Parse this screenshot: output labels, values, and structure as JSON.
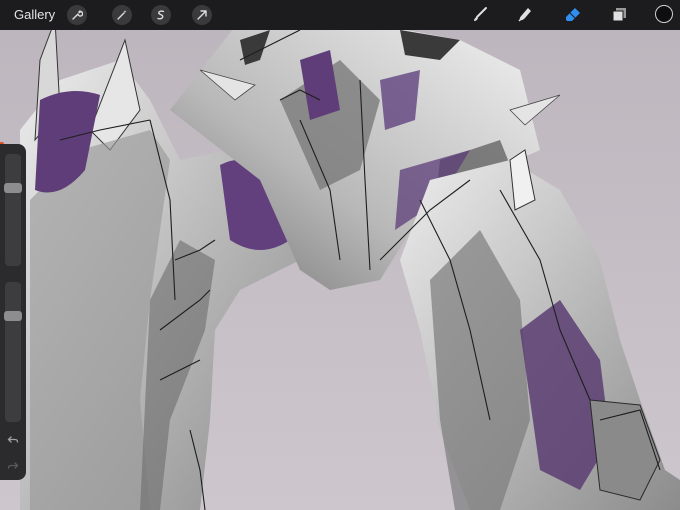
{
  "topbar": {
    "gallery_label": "Gallery",
    "left_tools": [
      "wrench-icon",
      "magic-wand-icon",
      "selection-icon",
      "transform-arrow-icon"
    ],
    "right_tools": [
      "brush-icon",
      "smudge-icon",
      "eraser-icon",
      "layers-icon"
    ],
    "active_tool": "eraser-icon",
    "current_color": "#0e0e10"
  },
  "sidebar": {
    "brush_size": 0.72,
    "brush_opacity": 0.78,
    "buttons": [
      "undo-icon",
      "redo-icon"
    ]
  },
  "colors": {
    "accent": "#2e8ff0",
    "purple_paint": "#5e3d78",
    "background_paint": "#c4bcc4"
  }
}
